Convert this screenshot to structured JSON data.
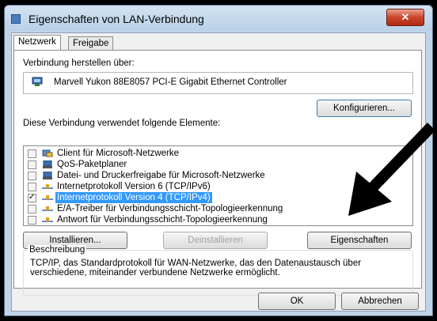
{
  "window": {
    "title": "Eigenschaften von LAN-Verbindung",
    "close_glyph": "✕"
  },
  "tabs": [
    {
      "label": "Netzwerk",
      "active": true
    },
    {
      "label": "Freigabe",
      "active": false
    }
  ],
  "connection": {
    "label": "Verbindung herstellen über:",
    "adapter": "Marvell Yukon 88E8057 PCI-E Gigabit Ethernet Controller",
    "configure_button": "Konfigurieren..."
  },
  "elements": {
    "label": "Diese Verbindung verwendet folgende Elemente:",
    "items": [
      {
        "label": "Client für Microsoft-Netzwerke",
        "checked": false,
        "selected": false,
        "icon": "client-icon"
      },
      {
        "label": "QoS-Paketplaner",
        "checked": false,
        "selected": false,
        "icon": "network-service-icon"
      },
      {
        "label": "Datei- und Druckerfreigabe für Microsoft-Netzwerke",
        "checked": false,
        "selected": false,
        "icon": "network-service-icon"
      },
      {
        "label": "Internetprotokoll Version 6 (TCP/IPv6)",
        "checked": false,
        "selected": false,
        "icon": "protocol-icon"
      },
      {
        "label": "Internetprotokoll Version 4 (TCP/IPv4)",
        "checked": true,
        "selected": true,
        "icon": "protocol-icon"
      },
      {
        "label": "E/A-Treiber für Verbindungsschicht-Topologieerkennung",
        "checked": false,
        "selected": false,
        "icon": "protocol-icon"
      },
      {
        "label": "Antwort für Verbindungsschicht-Topologieerkennung",
        "checked": false,
        "selected": false,
        "icon": "protocol-icon"
      }
    ]
  },
  "actions": {
    "install": "Installieren...",
    "uninstall": "Deinstallieren",
    "properties": "Eigenschaften"
  },
  "description": {
    "title": "Beschreibung",
    "text": "TCP/IP, das Standardprotokoll für WAN-Netzwerke, das den Datenaustausch über verschiedene, miteinander verbundene Netzwerke ermöglicht."
  },
  "footer": {
    "ok": "OK",
    "cancel": "Abbrechen"
  },
  "colors": {
    "selection": "#3399ff",
    "arrow": "#000000"
  }
}
